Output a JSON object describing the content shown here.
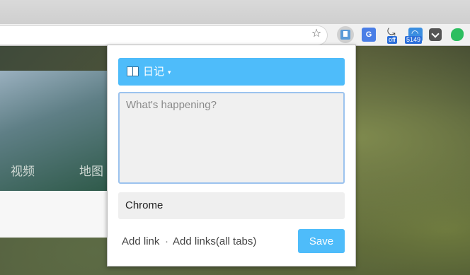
{
  "browser": {
    "badges": {
      "sync": "off",
      "rss": "5149"
    },
    "icons": [
      "star-icon",
      "extension-icon",
      "translate-icon",
      "sync-icon",
      "rss-icon",
      "pocket-icon",
      "evernote-icon"
    ]
  },
  "page": {
    "nav_items": [
      "视频",
      "地图"
    ]
  },
  "popup": {
    "category": {
      "label": "日记",
      "icon": "book-icon",
      "caret": "▾"
    },
    "note": {
      "placeholder": "What's happening?",
      "value": ""
    },
    "source_value": "Chrome",
    "links": {
      "add_link": "Add link",
      "separator": "·",
      "add_links_all_tabs": "Add links(all tabs)"
    },
    "save_label": "Save",
    "colors": {
      "accent": "#4ebcfa",
      "textarea_border": "#9cc3ee"
    }
  }
}
